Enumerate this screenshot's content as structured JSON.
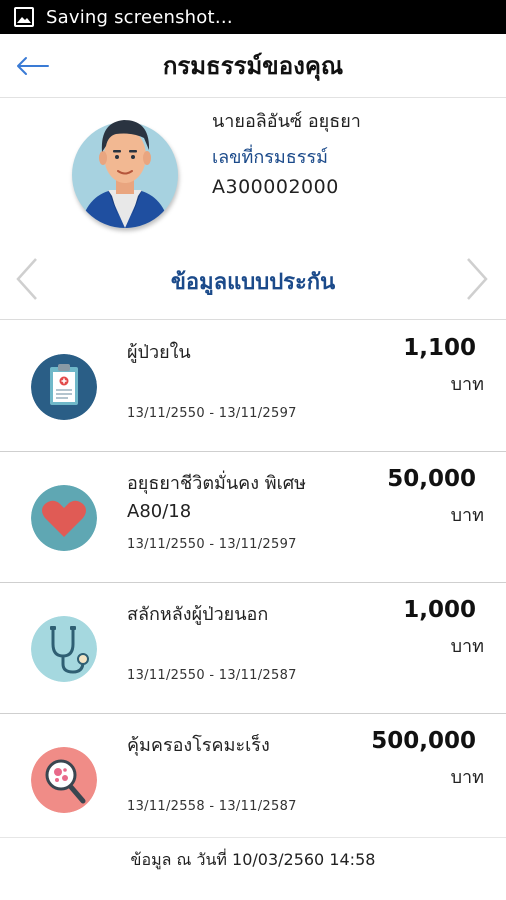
{
  "status_bar": {
    "text": "Saving screenshot…",
    "icon": "image-icon"
  },
  "header": {
    "title": "กรมธรรม์ของคุณ",
    "back_icon": "arrow-left-icon"
  },
  "profile": {
    "name": "นายอลิอันซ์  อยุธยา",
    "policy_label": "เลขที่กรมธรรม์",
    "policy_number": "A300002000"
  },
  "section": {
    "title": "ข้อมูลแบบประกัน"
  },
  "policies": [
    {
      "name": "ผู้ป่วยใน",
      "amount": "1,100",
      "unit": "บาท",
      "dates": "13/11/2550 - 13/11/2597",
      "icon": "clipboard-icon"
    },
    {
      "name": "อยุธยาชีวิตมั่นคง พิเศษ A80/18",
      "amount": "50,000",
      "unit": "บาท",
      "dates": "13/11/2550 - 13/11/2597",
      "icon": "heart-icon"
    },
    {
      "name": "สลักหลังผู้ป่วยนอก",
      "amount": "1,000",
      "unit": "บาท",
      "dates": "13/11/2550 - 13/11/2587",
      "icon": "stethoscope-icon"
    },
    {
      "name": "คุ้มครองโรคมะเร็ง",
      "amount": "500,000",
      "unit": "บาท",
      "dates": "13/11/2558 - 13/11/2587",
      "icon": "magnifier-icon"
    }
  ],
  "footer": {
    "text": "ข้อมูล ณ วันที่ 10/03/2560 14:58"
  },
  "colors": {
    "accent": "#1b4a8a",
    "back_arrow": "#3a7bd5"
  }
}
